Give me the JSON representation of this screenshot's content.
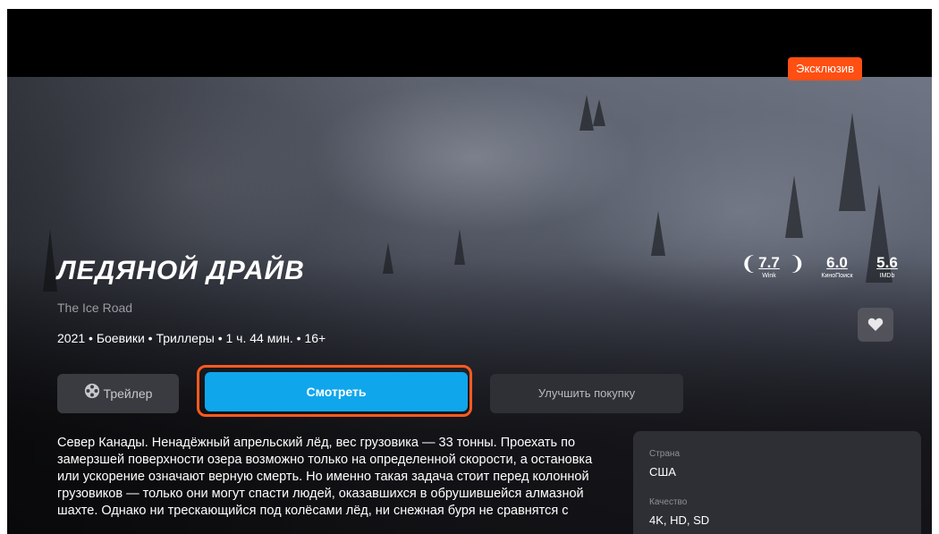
{
  "badge": "Эксклюзив",
  "movie": {
    "title": "ЛЕДЯНОЙ ДРАЙВ",
    "original_title": "The Ice Road",
    "meta": "2021 • Боевики • Триллеры • 1 ч. 44 мин. • 16+"
  },
  "ratings": [
    {
      "value": "7.7",
      "source": "Wink"
    },
    {
      "value": "6.0",
      "source": "КиноПоиск"
    },
    {
      "value": "5.6",
      "source": "IMDb"
    }
  ],
  "buttons": {
    "trailer": "Трейлер",
    "watch": "Смотреть",
    "upgrade": "Улучшить покупку"
  },
  "description": "Север Канады. Ненадёжный апрельский лёд, вес грузовика — 33 тонны. Проехать по замерзшей поверхности озера возможно только на определенной скорости, а остановка или ускорение означают верную смерть. Но именно такая задача стоит перед колонной грузовиков — только они могут спасти людей, оказавшихся в обрушившейся алмазной шахте. Однако ни трескающийся под колёсами лёд, ни снежная буря не сравнятся с",
  "info": {
    "country_label": "Страна",
    "country": "США",
    "quality_label": "Качество",
    "quality": "4K, HD, SD"
  },
  "icons": [
    "film-reel-icon",
    "heart-icon",
    "laurel-icon"
  ],
  "colors": {
    "accent": "#0fa6ec",
    "badge": "#ff4f12",
    "focus_ring": "#ff5a1f"
  }
}
